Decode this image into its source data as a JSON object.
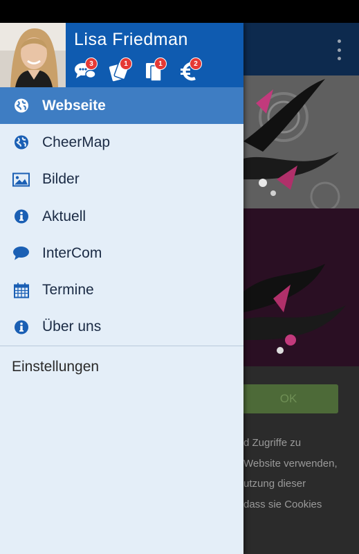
{
  "drawer": {
    "user_name": "Lisa Friedman",
    "header_icons": [
      {
        "icon": "chat-bubbles-icon",
        "badge": "3"
      },
      {
        "icon": "tickets-icon",
        "badge": "1"
      },
      {
        "icon": "documents-icon",
        "badge": "1"
      },
      {
        "icon": "euro-icon",
        "badge": "2"
      }
    ],
    "items": [
      {
        "label": "Webseite",
        "icon": "globe-icon",
        "active": true
      },
      {
        "label": "CheerMap",
        "icon": "globe-icon"
      },
      {
        "label": "Bilder",
        "icon": "image-icon"
      },
      {
        "label": "Aktuell",
        "icon": "info-icon"
      },
      {
        "label": "InterCom",
        "icon": "chat-icon"
      },
      {
        "label": "Termine",
        "icon": "calendar-icon"
      },
      {
        "label": "Über uns",
        "icon": "info-icon"
      }
    ],
    "settings_label": "Einstellungen"
  },
  "background": {
    "ok_label": "OK",
    "cookie_lines": [
      "d Zugriffe zu",
      " Website verwenden,",
      "utzung dieser",
      " dass sie Cookies"
    ]
  },
  "colors": {
    "header": "#0f5bb0",
    "active_item": "#3e7dc3",
    "drawer_bg": "#e4eef8",
    "icon_blue": "#1a5fb4",
    "badge": "#e53935"
  }
}
